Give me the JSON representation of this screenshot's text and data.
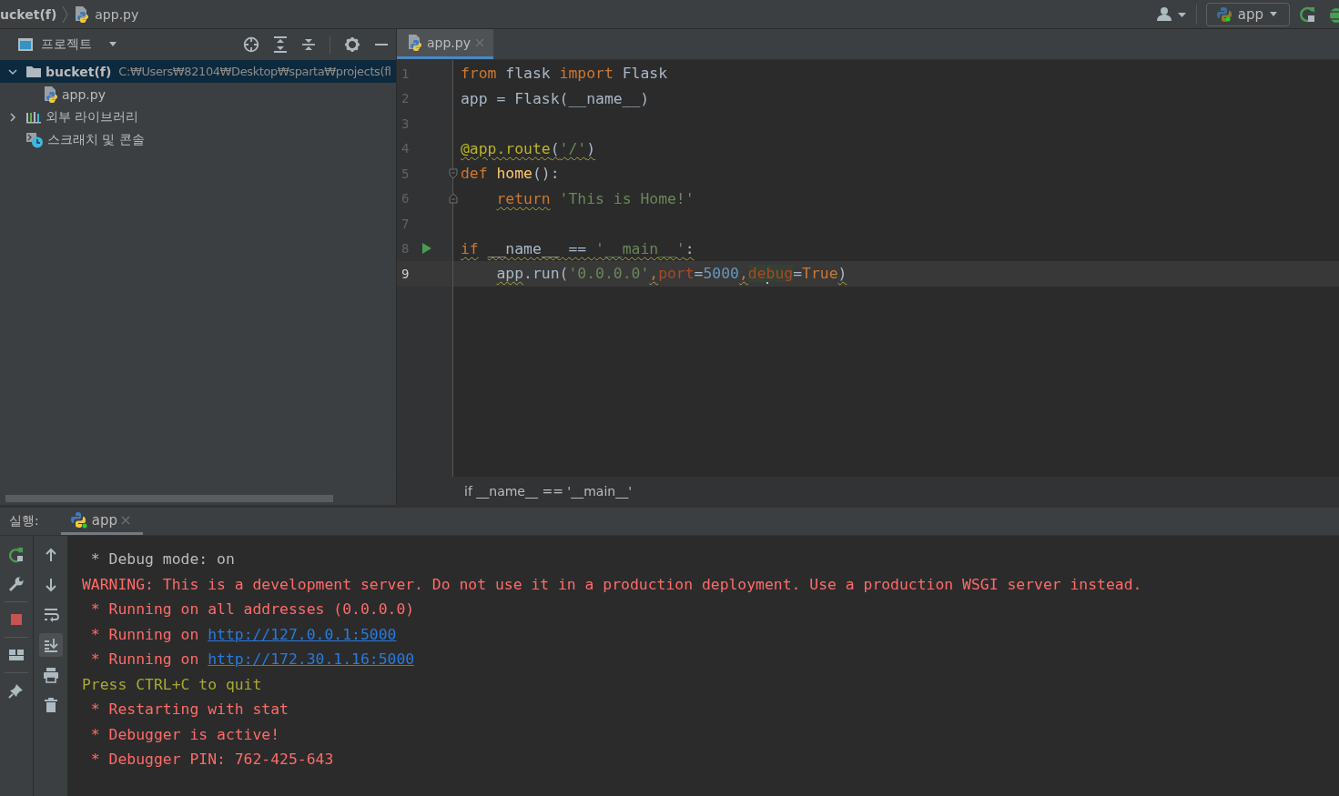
{
  "navbar": {
    "breadcrumb": [
      {
        "label": "ucket(f)",
        "kind": "folder"
      },
      {
        "label": "app.py",
        "kind": "python-file"
      }
    ],
    "run_config": "app"
  },
  "project_panel": {
    "title": "프로젝트",
    "tree": [
      {
        "label": "bucket(f)",
        "kind": "folder",
        "hint": "C:₩Users₩82104₩Desktop₩sparta₩projects(fl",
        "expanded": true,
        "selected": true,
        "children": [
          {
            "label": "app.py",
            "kind": "python-file",
            "selected": false
          }
        ]
      },
      {
        "label": "외부 라이브러리",
        "kind": "library",
        "expanded": false,
        "selected": false
      },
      {
        "label": "스크래치 및 콘솔",
        "kind": "scratch",
        "selected": false
      }
    ]
  },
  "editor": {
    "tabs": [
      {
        "label": "app.py",
        "selected": true
      }
    ],
    "lines": [
      {
        "number": "1",
        "kind": "plain",
        "current": false,
        "tokens": [
          {
            "t": "from",
            "color": "#cc7832",
            "warn": false
          },
          {
            "t": " flask ",
            "color": "#a9b7c6",
            "warn": false
          },
          {
            "t": "import",
            "color": "#cc7832",
            "warn": false
          },
          {
            "t": " Flask",
            "color": "#a9b7c6",
            "warn": false
          }
        ]
      },
      {
        "number": "2",
        "kind": "plain",
        "current": false,
        "tokens": [
          {
            "t": "app = Flask(__name__)",
            "color": "#a9b7c6",
            "warn": false
          }
        ]
      },
      {
        "number": "3",
        "kind": "plain",
        "current": false
      },
      {
        "number": "4",
        "kind": "plain",
        "current": false,
        "tokens": [
          {
            "t": "@app.route",
            "color": "#bbb529",
            "warn": true
          },
          {
            "t": "(",
            "color": "#a9b7c6",
            "warn": true
          },
          {
            "t": "'/'",
            "color": "#6a8759",
            "warn": true
          },
          {
            "t": ")",
            "color": "#a9b7c6",
            "warn": true
          }
        ]
      },
      {
        "number": "5",
        "kind": "fold-start",
        "current": false,
        "tokens": [
          {
            "t": "def ",
            "color": "#cc7832",
            "warn": false
          },
          {
            "t": "home",
            "color": "#ffc66d",
            "warn": false
          },
          {
            "t": "():",
            "color": "#a9b7c6",
            "warn": false
          }
        ]
      },
      {
        "number": "6",
        "kind": "fold-end",
        "current": false,
        "tokens": [
          {
            "t": "    return",
            "color": "#cc7832",
            "warn": true
          },
          {
            "t": " 'This is Home!'",
            "color": "#6a8759",
            "warn": false
          }
        ]
      },
      {
        "number": "7",
        "kind": "plain",
        "current": false
      },
      {
        "number": "8",
        "kind": "run",
        "current": false,
        "tokens": [
          {
            "t": "if",
            "color": "#cc7832",
            "warn": true
          },
          {
            "t": " __name__ == ",
            "color": "#a9b7c6",
            "warn": true
          },
          {
            "t": "'__main__'",
            "color": "#6a8759",
            "warn": true
          },
          {
            "t": ":",
            "color": "#a9b7c6",
            "warn": true
          }
        ]
      },
      {
        "number": "9",
        "kind": "plain",
        "current": true,
        "tokens": [
          {
            "t": "    app",
            "color": "#a9b7c6",
            "warn": true
          },
          {
            "t": ".run(",
            "color": "#a9b7c6",
            "warn": false
          },
          {
            "t": "'0.0.0.0'",
            "color": "#6a8759",
            "warn": false
          },
          {
            "t": ",",
            "color": "#cc7832",
            "warn": true
          },
          {
            "t": "port",
            "color": "#aa4926",
            "warn": false
          },
          {
            "t": "=",
            "color": "#a9b7c6",
            "warn": false
          },
          {
            "t": "5000",
            "color": "#6897bb",
            "warn": false
          },
          {
            "t": ",",
            "color": "#cc7832",
            "warn": true
          },
          {
            "t": "de",
            "color": "#aa4926",
            "warn": false,
            "highlight": true,
            "caret": true
          },
          {
            "t": "bug",
            "color": "#aa4926",
            "warn": false,
            "highlight": true
          },
          {
            "t": "=",
            "color": "#a9b7c6",
            "warn": false
          },
          {
            "t": "True",
            "color": "#cc7832",
            "warn": false
          },
          {
            "t": ")",
            "color": "#a9b7c6",
            "warn": true
          }
        ]
      }
    ],
    "breadcrumb": "if __name__ == '__main__'"
  },
  "run_panel": {
    "label": "실행:",
    "tabs": [
      {
        "label": "app",
        "selected": true
      }
    ],
    "toolbar_left": [
      {
        "kind": "rerun"
      },
      {
        "kind": "wrench"
      },
      {
        "kind": "stop"
      },
      {
        "kind": "layout"
      },
      {
        "kind": "pin"
      }
    ],
    "toolbar_right": [
      {
        "kind": "up",
        "on": false
      },
      {
        "kind": "down",
        "on": false
      },
      {
        "kind": "wrap",
        "on": false
      },
      {
        "kind": "scroll-end",
        "on": true
      },
      {
        "kind": "print",
        "on": false
      },
      {
        "kind": "trash",
        "on": false
      }
    ],
    "console": [
      {
        "kind": "plain",
        "parts": [
          {
            "text": " * Debug mode: on"
          }
        ]
      },
      {
        "kind": "error",
        "parts": [
          {
            "text": "WARNING: This is a development server. Do not use it in a production deployment. Use a production WSGI server instead."
          }
        ]
      },
      {
        "kind": "error",
        "parts": [
          {
            "text": " * Running on all addresses (0.0.0.0)"
          }
        ]
      },
      {
        "kind": "error",
        "parts": [
          {
            "text": " * Running on "
          },
          {
            "text": "http://127.0.0.1:5000",
            "link": true
          }
        ]
      },
      {
        "kind": "error",
        "parts": [
          {
            "text": " * Running on "
          },
          {
            "text": "http://172.30.1.16:5000",
            "link": true
          }
        ]
      },
      {
        "kind": "warning",
        "parts": [
          {
            "text": "Press CTRL+C to quit"
          }
        ]
      },
      {
        "kind": "error",
        "parts": [
          {
            "text": " * Restarting with stat"
          }
        ]
      },
      {
        "kind": "error",
        "parts": [
          {
            "text": " * Debugger is active!"
          }
        ]
      },
      {
        "kind": "error",
        "parts": [
          {
            "text": " * Debugger PIN: 762-425-643"
          }
        ]
      }
    ]
  }
}
